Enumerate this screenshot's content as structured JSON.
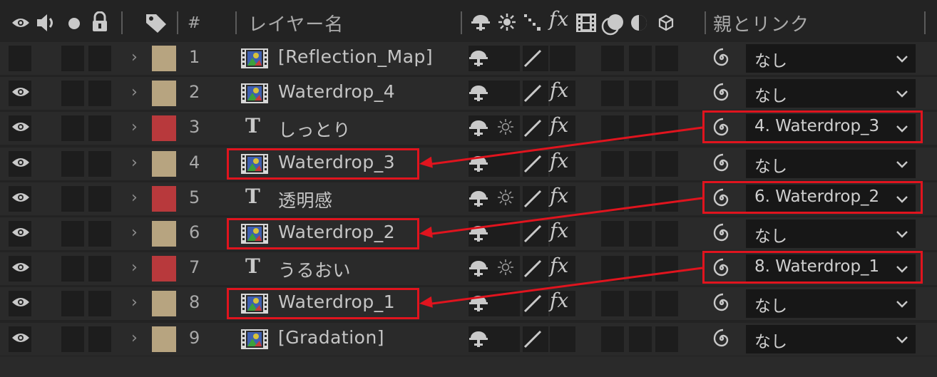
{
  "header": {
    "layer_name_label": "レイヤー名",
    "number_label": "#",
    "parent_link_label": "親とリンク",
    "fx_label": "fx"
  },
  "layers": [
    {
      "num": "1",
      "type": "footage",
      "name": "[Reflection_Map]",
      "color": "#b7a480",
      "eye": false,
      "fx": false,
      "sun": false,
      "parent": "なし",
      "highlight_name": false,
      "highlight_parent": false
    },
    {
      "num": "2",
      "type": "footage",
      "name": "Waterdrop_4",
      "color": "#b7a480",
      "eye": true,
      "fx": true,
      "sun": false,
      "parent": "なし",
      "highlight_name": false,
      "highlight_parent": false
    },
    {
      "num": "3",
      "type": "text",
      "name": "しっとり",
      "color": "#b8393c",
      "eye": true,
      "fx": true,
      "sun": true,
      "parent": "4. Waterdrop_3",
      "highlight_name": false,
      "highlight_parent": true
    },
    {
      "num": "4",
      "type": "footage",
      "name": "Waterdrop_3",
      "color": "#b7a480",
      "eye": true,
      "fx": true,
      "sun": false,
      "parent": "なし",
      "highlight_name": true,
      "highlight_parent": false
    },
    {
      "num": "5",
      "type": "text",
      "name": "透明感",
      "color": "#b8393c",
      "eye": true,
      "fx": true,
      "sun": true,
      "parent": "6. Waterdrop_2",
      "highlight_name": false,
      "highlight_parent": true
    },
    {
      "num": "6",
      "type": "footage",
      "name": "Waterdrop_2",
      "color": "#b7a480",
      "eye": true,
      "fx": true,
      "sun": false,
      "parent": "なし",
      "highlight_name": true,
      "highlight_parent": false
    },
    {
      "num": "7",
      "type": "text",
      "name": "うるおい",
      "color": "#b8393c",
      "eye": true,
      "fx": true,
      "sun": true,
      "parent": "8. Waterdrop_1",
      "highlight_name": false,
      "highlight_parent": true
    },
    {
      "num": "8",
      "type": "footage",
      "name": "Waterdrop_1",
      "color": "#b7a480",
      "eye": true,
      "fx": true,
      "sun": false,
      "parent": "なし",
      "highlight_name": true,
      "highlight_parent": false
    },
    {
      "num": "9",
      "type": "footage",
      "name": "[Gradation]",
      "color": "#b7a480",
      "eye": true,
      "fx": false,
      "sun": false,
      "parent": "なし",
      "highlight_name": false,
      "highlight_parent": false
    }
  ],
  "colors": {
    "highlight": "#e0141e",
    "footage_label": "#b7a480",
    "text_label": "#b8393c"
  },
  "icons": [
    "eye-icon",
    "speaker-icon",
    "solo-dot-icon",
    "lock-icon",
    "label-tag-icon",
    "shy-icon",
    "collapse-sun-icon",
    "quality-slash-icon",
    "fx-icon",
    "frame-blend-icon",
    "motion-blur-icon",
    "adjustment-icon",
    "3d-cube-icon",
    "pickwhip-icon",
    "chevron-down-icon",
    "chevron-right-icon",
    "footage-icon",
    "text-layer-icon"
  ]
}
